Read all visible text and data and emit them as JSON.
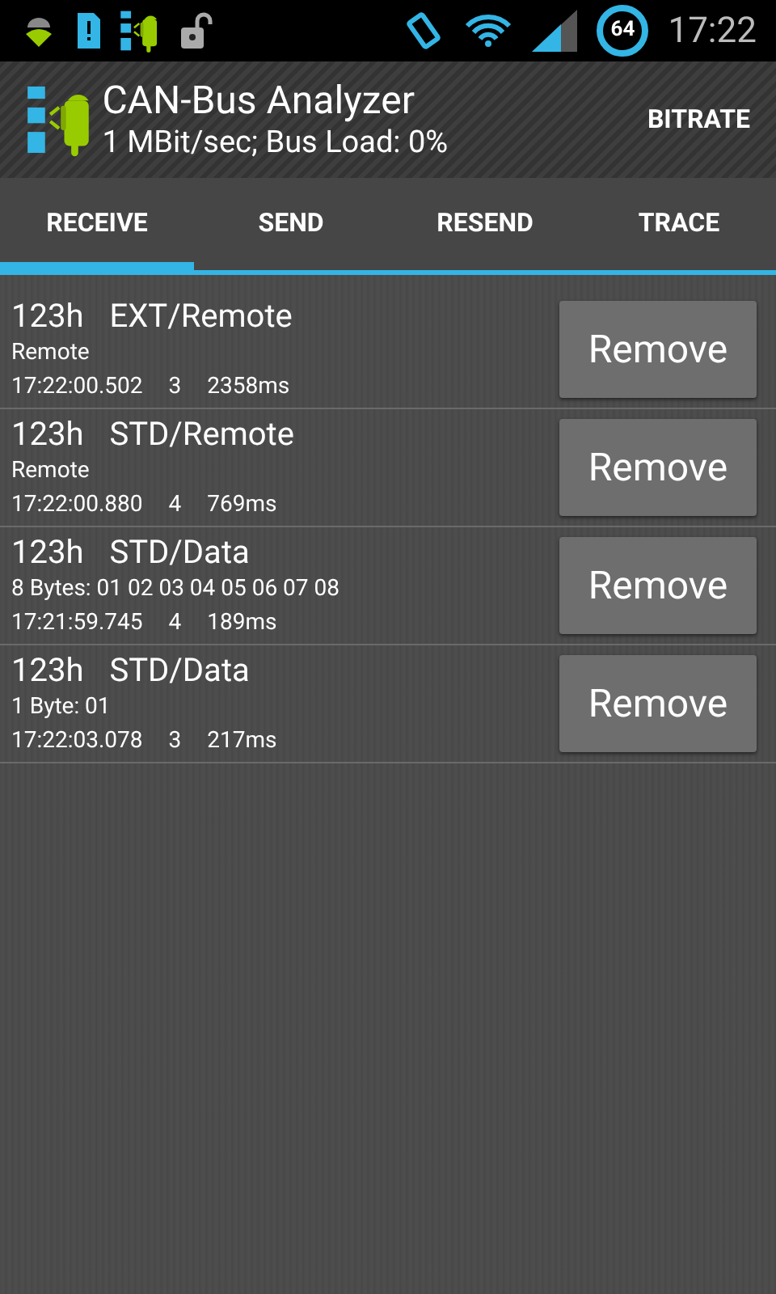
{
  "status_bar": {
    "battery_text": "64",
    "time": "17:22"
  },
  "action_bar": {
    "title": "CAN-Bus Analyzer",
    "subtitle": "1 MBit/sec; Bus Load: 0%",
    "action": "BITRATE"
  },
  "tabs": [
    {
      "label": "RECEIVE",
      "selected": true
    },
    {
      "label": "SEND",
      "selected": false
    },
    {
      "label": "RESEND",
      "selected": false
    },
    {
      "label": "TRACE",
      "selected": false
    }
  ],
  "messages": [
    {
      "id": "123h",
      "type": "EXT/Remote",
      "data": "Remote",
      "time": "17:22:00.502",
      "count": "3",
      "period": "2358ms",
      "button": "Remove"
    },
    {
      "id": "123h",
      "type": "STD/Remote",
      "data": "Remote",
      "time": "17:22:00.880",
      "count": "4",
      "period": "769ms",
      "button": "Remove"
    },
    {
      "id": "123h",
      "type": "STD/Data",
      "data": "8 Bytes: 01 02 03 04 05 06 07 08",
      "time": "17:21:59.745",
      "count": "4",
      "period": "189ms",
      "button": "Remove"
    },
    {
      "id": "123h",
      "type": "STD/Data",
      "data": "1 Byte: 01",
      "time": "17:22:03.078",
      "count": "3",
      "period": "217ms",
      "button": "Remove"
    }
  ]
}
